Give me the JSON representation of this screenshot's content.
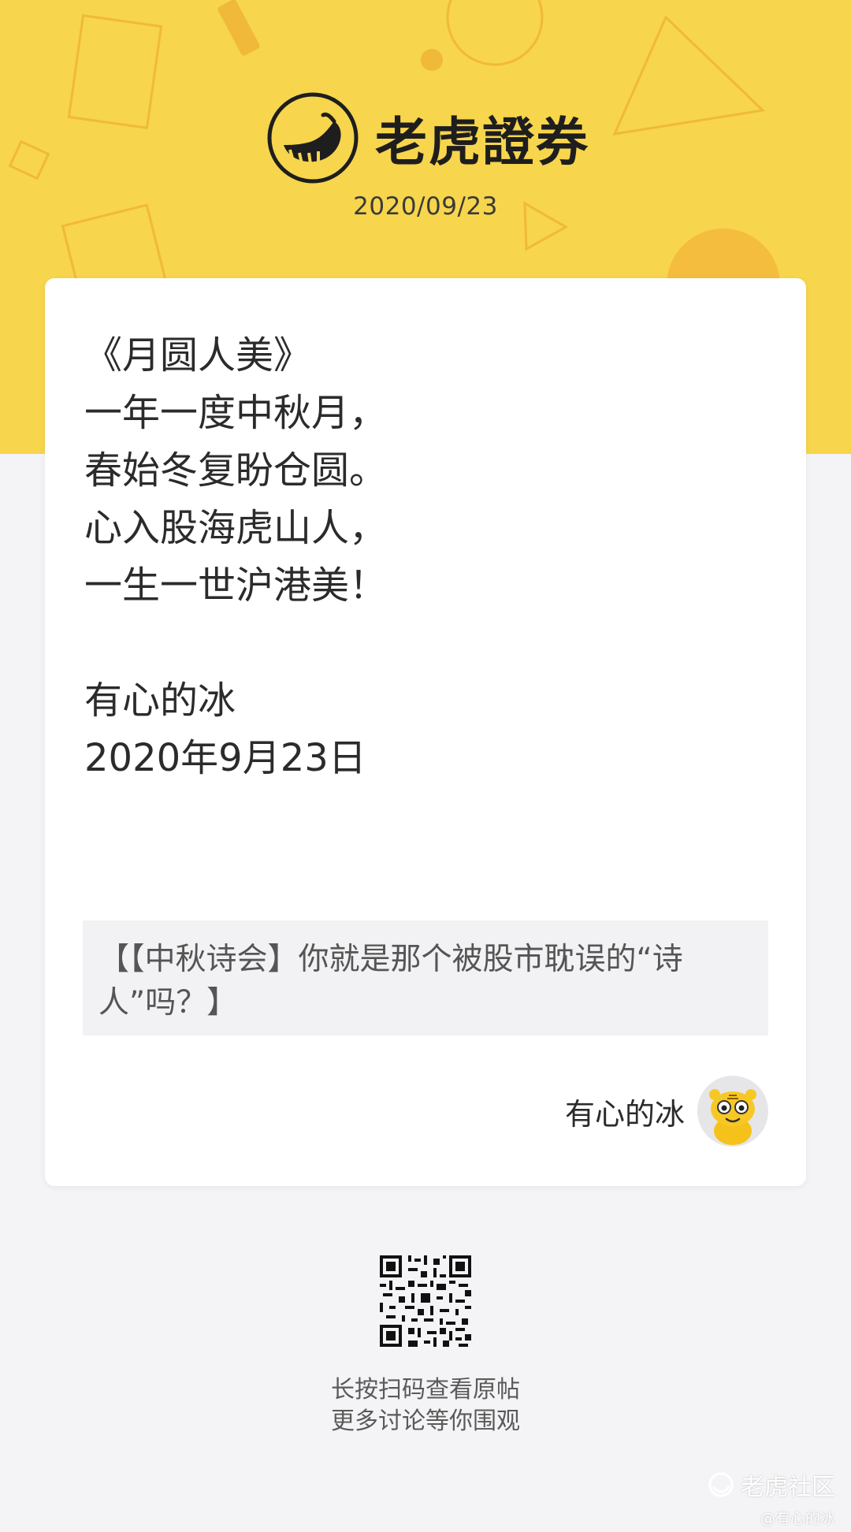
{
  "header": {
    "brand_name": "老虎證券",
    "date": "2020/09/23",
    "background_color": "#f7d54c"
  },
  "post": {
    "lines": [
      "《月圆人美》",
      "一年一度中秋月，",
      "春始冬复盼仓圆。",
      "心入股海虎山人，",
      "一生一世沪港美！",
      "",
      "有心的冰",
      "2020年9月23日"
    ],
    "topic": "【【中秋诗会】你就是那个被股市耽误的“诗人”吗？】",
    "author": "有心的冰",
    "avatar_icon": "tiger-avatar-icon"
  },
  "footer": {
    "qr_icon": "qr-code-icon",
    "caption_line1": "长按扫码查看原帖",
    "caption_line2": "更多讨论等你围观"
  },
  "watermark": {
    "brand": "老虎社区",
    "user": "@有心的冰"
  }
}
